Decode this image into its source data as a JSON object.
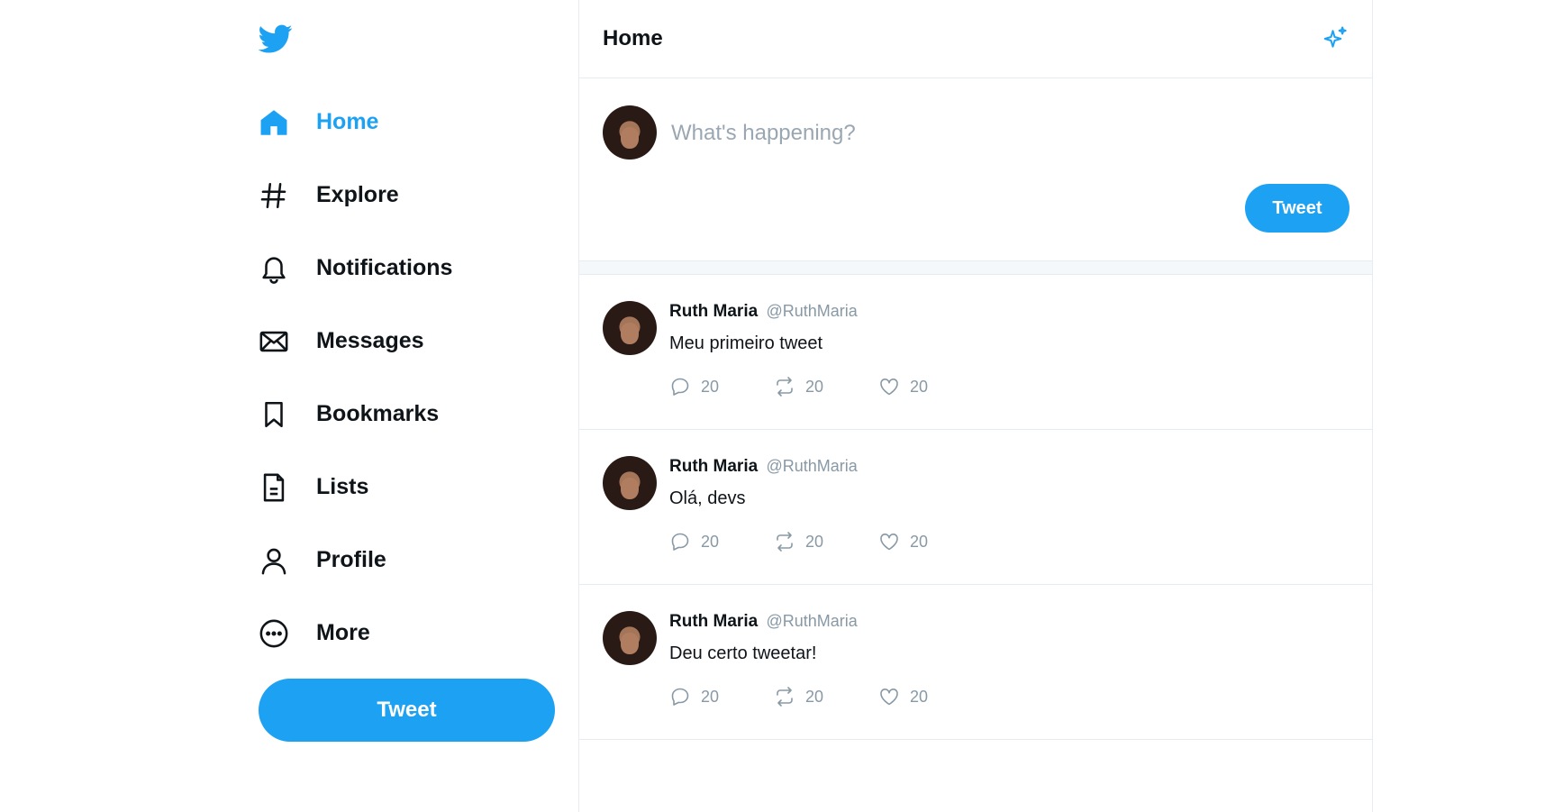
{
  "sidebar": {
    "logo": "twitter-bird-icon",
    "items": [
      {
        "label": "Home",
        "icon": "home-icon",
        "active": true
      },
      {
        "label": "Explore",
        "icon": "hashtag-icon"
      },
      {
        "label": "Notifications",
        "icon": "bell-icon"
      },
      {
        "label": "Messages",
        "icon": "envelope-icon"
      },
      {
        "label": "Bookmarks",
        "icon": "bookmark-icon"
      },
      {
        "label": "Lists",
        "icon": "list-document-icon"
      },
      {
        "label": "Profile",
        "icon": "user-icon"
      },
      {
        "label": "More",
        "icon": "more-circle-icon"
      }
    ],
    "tweet_button": "Tweet"
  },
  "header": {
    "title": "Home",
    "icon": "sparkle-icon"
  },
  "composer": {
    "placeholder": "What's happening?",
    "button": "Tweet"
  },
  "tweets": [
    {
      "name": "Ruth Maria",
      "handle": "@RuthMaria",
      "text": "Meu primeiro tweet",
      "replies": "20",
      "retweets": "20",
      "likes": "20"
    },
    {
      "name": "Ruth Maria",
      "handle": "@RuthMaria",
      "text": "Olá, devs",
      "replies": "20",
      "retweets": "20",
      "likes": "20"
    },
    {
      "name": "Ruth Maria",
      "handle": "@RuthMaria",
      "text": "Deu certo tweetar!",
      "replies": "20",
      "retweets": "20",
      "likes": "20"
    }
  ],
  "colors": {
    "accent": "#1da1f2",
    "text": "#0f1419",
    "muted": "#8899a6",
    "border": "#e6ecf0"
  }
}
